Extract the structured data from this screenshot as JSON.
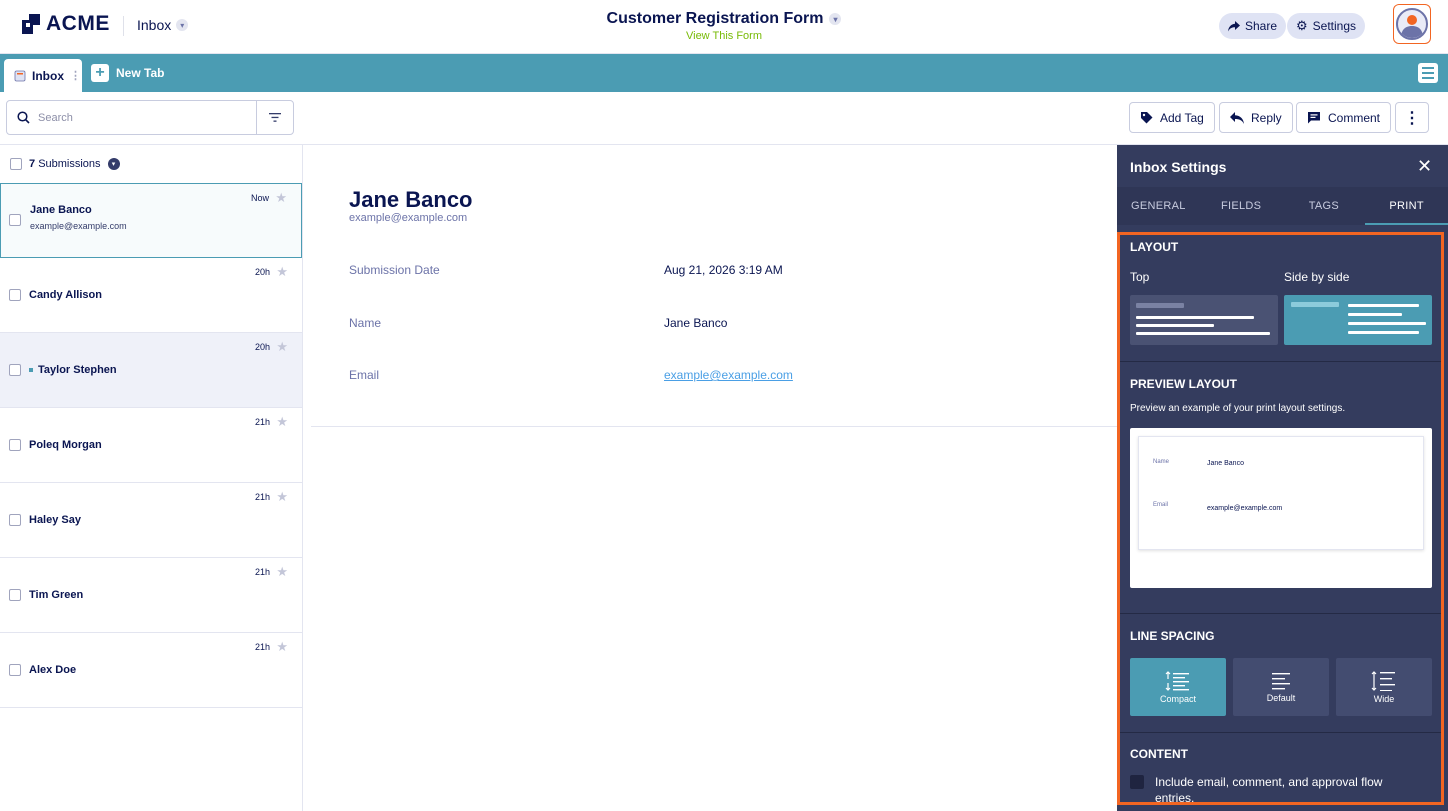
{
  "app": {
    "brand": "ACME",
    "inbox_switch": "Inbox",
    "form_title": "Customer Registration Form",
    "view_form": "View This Form",
    "share": "Share",
    "settings": "Settings"
  },
  "tabs": {
    "inbox": "Inbox",
    "new_tab": "New Tab"
  },
  "toolbar": {
    "search_placeholder": "Search",
    "add_tag": "Add Tag",
    "reply": "Reply",
    "comment": "Comment"
  },
  "list": {
    "count": "7",
    "count_label": "Submissions",
    "items": [
      {
        "name": "Jane Banco",
        "email": "example@example.com",
        "time": "Now"
      },
      {
        "name": "Candy Allison",
        "email": "",
        "time": "20h"
      },
      {
        "name": "Taylor Stephen",
        "email": "",
        "time": "20h"
      },
      {
        "name": "Poleq Morgan",
        "email": "",
        "time": "21h"
      },
      {
        "name": "Haley Say",
        "email": "",
        "time": "21h"
      },
      {
        "name": "Tim Green",
        "email": "",
        "time": "21h"
      },
      {
        "name": "Alex Doe",
        "email": "",
        "time": "21h"
      }
    ]
  },
  "detail": {
    "name": "Jane Banco",
    "email": "example@example.com",
    "fields": [
      {
        "label": "Submission Date",
        "value": "Aug 21, 2026 3:19 AM"
      },
      {
        "label": "Name",
        "value": "Jane Banco"
      },
      {
        "label": "Email",
        "value": "example@example.com"
      }
    ]
  },
  "panel": {
    "title": "Inbox Settings",
    "tabs": [
      "GENERAL",
      "FIELDS",
      "TAGS",
      "PRINT"
    ],
    "layout_heading": "LAYOUT",
    "layout_top": "Top",
    "layout_side": "Side by side",
    "preview_heading": "PREVIEW LAYOUT",
    "preview_text": "Preview an example of your print layout settings.",
    "preview_name_label": "Name",
    "preview_name_value": "Jane Banco",
    "preview_email_label": "Email",
    "preview_email_value": "example@example.com",
    "spacing_heading": "LINE SPACING",
    "spacing": [
      "Compact",
      "Default",
      "Wide"
    ],
    "content_heading": "CONTENT",
    "content_option": "Include email, comment, and approval flow entries."
  },
  "colors": {
    "accent": "#4b9cb3",
    "panel_bg": "#343c5e",
    "highlight_border": "#f26522",
    "link": "#4a9fe5",
    "view_form": "#78bb07"
  }
}
